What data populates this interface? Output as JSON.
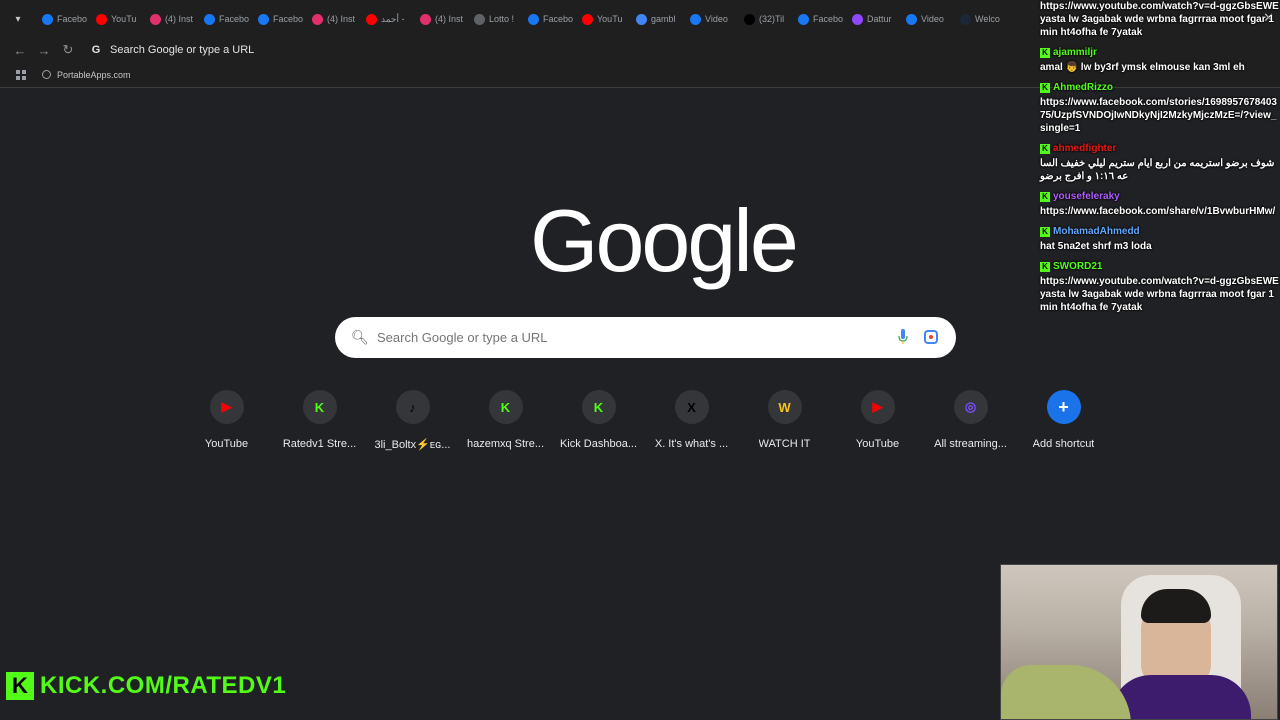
{
  "tabs": [
    {
      "label": "Facebo",
      "icon": "facebook-icon",
      "color": "#1877f2"
    },
    {
      "label": "YouTu",
      "icon": "youtube-icon",
      "color": "#ff0000"
    },
    {
      "label": "(4) Inst",
      "icon": "instagram-icon",
      "color": "#e1306c"
    },
    {
      "label": "Facebo",
      "icon": "facebook-icon",
      "color": "#1877f2"
    },
    {
      "label": "Facebo",
      "icon": "facebook-icon",
      "color": "#1877f2"
    },
    {
      "label": "(4) Inst",
      "icon": "instagram-icon",
      "color": "#e1306c"
    },
    {
      "label": "أحمد -",
      "icon": "youtube-icon",
      "color": "#ff0000"
    },
    {
      "label": "(4) Inst",
      "icon": "instagram-icon",
      "color": "#e1306c"
    },
    {
      "label": "Lotto !",
      "icon": "grid-icon",
      "color": "#5f6368"
    },
    {
      "label": "Facebo",
      "icon": "facebook-icon",
      "color": "#1877f2"
    },
    {
      "label": "YouTu",
      "icon": "youtube-icon",
      "color": "#ff0000"
    },
    {
      "label": "gambl",
      "icon": "google-icon",
      "color": "#4285f4"
    },
    {
      "label": "Video",
      "icon": "facebook-icon",
      "color": "#1877f2"
    },
    {
      "label": "(32)Til",
      "icon": "tiktok-icon",
      "color": "#000000"
    },
    {
      "label": "Facebo",
      "icon": "facebook-icon",
      "color": "#1877f2"
    },
    {
      "label": "Dattur",
      "icon": "twitch-icon",
      "color": "#9146ff"
    },
    {
      "label": "Video",
      "icon": "facebook-icon",
      "color": "#1877f2"
    },
    {
      "label": "Welco",
      "icon": "steam-icon",
      "color": "#1b2838"
    }
  ],
  "toolbar": {
    "omnibox_text": "Search Google or type a URL"
  },
  "bookmarks": {
    "items": [
      {
        "label": "PortableApps.com"
      }
    ]
  },
  "google": {
    "logo_text": "Google",
    "search_placeholder": "Search Google or type a URL"
  },
  "shortcuts": [
    {
      "label": "YouTube",
      "glyph": "▶",
      "color": "#ff0000"
    },
    {
      "label": "Ratedv1 Stre...",
      "glyph": "K",
      "color": "#53fc18"
    },
    {
      "label": "3li_Boltx⚡ᴇɢ...",
      "glyph": "♪",
      "color": "#000000"
    },
    {
      "label": "hazemxq Stre...",
      "glyph": "K",
      "color": "#53fc18"
    },
    {
      "label": "Kick Dashboa...",
      "glyph": "K",
      "color": "#53fc18"
    },
    {
      "label": "X. It's what's ...",
      "glyph": "X",
      "color": "#000000"
    },
    {
      "label": "WATCH IT",
      "glyph": "W",
      "color": "#f5c518"
    },
    {
      "label": "YouTube",
      "glyph": "▶",
      "color": "#ff0000"
    },
    {
      "label": "All streaming...",
      "glyph": "◎",
      "color": "#7c4dff"
    },
    {
      "label": "Add shortcut",
      "glyph": "+",
      "color": "#1a73e8"
    }
  ],
  "chat": {
    "messages": [
      {
        "user": "",
        "user_color": "#ffffff",
        "text": "https://www.youtube.com/watch?v=d-ggzGbsEWE yasta lw 3agabak wde wrbna fagrrraa moot fgar 1 min ht4ofha fe 7yatak"
      },
      {
        "user": "ajammiljr",
        "user_color": "#53fc18",
        "text": "amal 👦 lw by3rf ymsk elmouse kan 3ml eh"
      },
      {
        "user": "AhmedRizzo",
        "user_color": "#53fc18",
        "text": "https://www.facebook.com/stories/169895767840375/UzpfSVNDOjIwNDkyNjI2MzkyMjczMzE=/?view_single=1"
      },
      {
        "user": "ahmedfighter",
        "user_color": "#e91916",
        "text": "شوف برضو استريمه من اربع ايام ستريم ليلي خفيف الساعه ١:١٦ و افرج برضو"
      },
      {
        "user": "yousefeleraky",
        "user_color": "#b05cff",
        "text": "https://www.facebook.com/share/v/1BvwburHMw/"
      },
      {
        "user": "MohamadAhmedd",
        "user_color": "#5fa8ff",
        "text": "hat 5na2et shrf m3 loda"
      },
      {
        "user": "SWORD21",
        "user_color": "#53fc18",
        "text": "https://www.youtube.com/watch?v=d-ggzGbsEWE yasta lw 3agabak wde wrbna fagrrraa moot fgar 1 min ht4ofha fe 7yatak"
      }
    ]
  },
  "stream": {
    "channel_text": "KICK.COM/RATEDV1",
    "brand_color": "#53fc18"
  }
}
